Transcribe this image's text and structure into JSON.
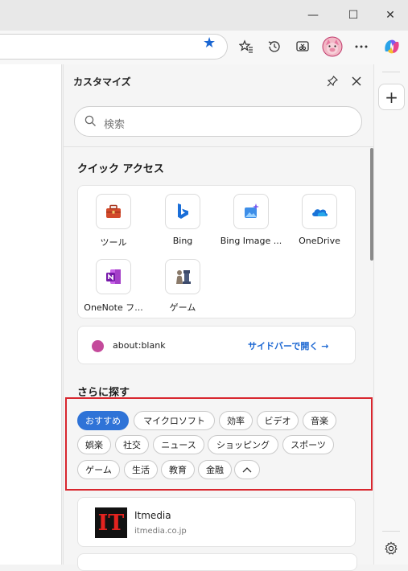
{
  "window": {
    "minimize_glyph": "—",
    "maximize_glyph": "☐",
    "close_glyph": "✕"
  },
  "panel": {
    "title": "カスタマイズ",
    "search_placeholder": "検索",
    "quick_access_title": "クイック アクセス",
    "quick_access": [
      {
        "label": "ツール",
        "icon": "toolbox-icon"
      },
      {
        "label": "Bing",
        "icon": "bing-icon"
      },
      {
        "label": "Bing Image ...",
        "icon": "bing-image-creator-icon"
      },
      {
        "label": "OneDrive",
        "icon": "onedrive-icon"
      },
      {
        "label": "OneNote フ...",
        "icon": "onenote-icon"
      },
      {
        "label": "ゲーム",
        "icon": "chess-icon"
      }
    ],
    "blank_page": {
      "url": "about:blank",
      "action": "サイドバーで開く"
    },
    "explore_title": "さらに探す",
    "tags": [
      "おすすめ",
      "マイクロソフト",
      "効率",
      "ビデオ",
      "音楽",
      "娯楽",
      "社交",
      "ニュース",
      "ショッピング",
      "スポーツ",
      "ゲーム",
      "生活",
      "教育",
      "金融"
    ],
    "active_tag": "おすすめ",
    "news": {
      "logo_text": "IT",
      "name": "Itmedia",
      "url": "itmedia.co.jp"
    }
  },
  "colors": {
    "accent": "#2f73d7",
    "highlight_frame": "#d8262e"
  }
}
